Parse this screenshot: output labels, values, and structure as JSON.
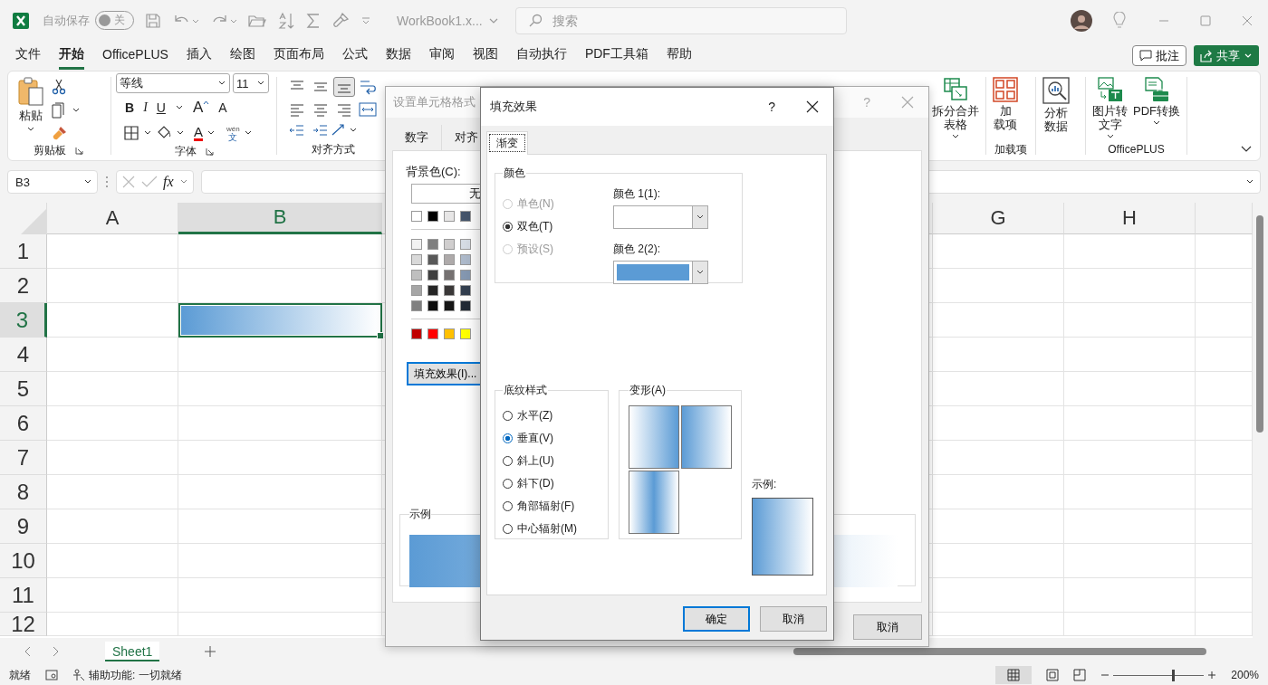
{
  "titlebar": {
    "autosave_label": "自动保存",
    "autosave_toggle": {
      "label": "关",
      "on": false
    },
    "filename": "WorkBook1.x...",
    "search": {
      "placeholder": "搜索"
    }
  },
  "menu_tabs": [
    {
      "label": "文件",
      "selected": false
    },
    {
      "label": "开始",
      "selected": true
    },
    {
      "label": "OfficePLUS",
      "selected": false
    },
    {
      "label": "插入",
      "selected": false
    },
    {
      "label": "绘图",
      "selected": false
    },
    {
      "label": "页面布局",
      "selected": false
    },
    {
      "label": "公式",
      "selected": false
    },
    {
      "label": "数据",
      "selected": false
    },
    {
      "label": "审阅",
      "selected": false
    },
    {
      "label": "视图",
      "selected": false
    },
    {
      "label": "自动执行",
      "selected": false
    },
    {
      "label": "PDF工具箱",
      "selected": false
    },
    {
      "label": "帮助",
      "selected": false
    }
  ],
  "header_actions": {
    "comment": "批注",
    "share": "共享"
  },
  "ribbon": {
    "clipboard": {
      "paste": "粘贴",
      "group": "剪贴板"
    },
    "font": {
      "name": "等线",
      "size": "11",
      "bold": "B",
      "italic": "I",
      "underline": "U",
      "grow": "A",
      "shrink": "A",
      "font_color": "A",
      "phonetic_top": "wén",
      "phonetic_bottom": "文",
      "group": "字体"
    },
    "alignment": {
      "vertical": [
        {
          "selected": false
        },
        {
          "selected": false
        },
        {
          "selected": true
        }
      ],
      "group": "对齐方式"
    },
    "right_groups": [
      {
        "buttons": [
          {
            "kind": "split",
            "lines": [
              "拆分合并",
              "表格"
            ],
            "caret": true
          }
        ]
      },
      {
        "label": "加载项",
        "buttons": [
          {
            "kind": "addins",
            "lines": [
              "加",
              "载项"
            ],
            "caret": false
          }
        ]
      },
      {
        "buttons": [
          {
            "kind": "analyze",
            "lines": [
              "分析",
              "数据"
            ],
            "caret": false
          }
        ]
      },
      {
        "label": "OfficePLUS",
        "buttons": [
          {
            "kind": "image-text",
            "lines": [
              "图片转",
              "文字"
            ],
            "caret": true
          },
          {
            "kind": "pdf",
            "lines": [
              "PDF转换"
            ],
            "caret": true
          }
        ]
      }
    ]
  },
  "formula_bar": {
    "name_box": "B3",
    "fx": "fx"
  },
  "grid": {
    "columns": [
      {
        "label": "A",
        "selected": false
      },
      {
        "label": "B",
        "selected": true
      },
      {
        "label": "G",
        "selected": false
      },
      {
        "label": "H",
        "selected": false
      }
    ],
    "rows": [
      {
        "label": "1",
        "selected": false
      },
      {
        "label": "2",
        "selected": false
      },
      {
        "label": "3",
        "selected": true
      },
      {
        "label": "4",
        "selected": false
      },
      {
        "label": "5",
        "selected": false
      },
      {
        "label": "6",
        "selected": false
      },
      {
        "label": "7",
        "selected": false
      },
      {
        "label": "8",
        "selected": false
      },
      {
        "label": "9",
        "selected": false
      },
      {
        "label": "10",
        "selected": false
      },
      {
        "label": "11",
        "selected": false
      },
      {
        "label": "12",
        "selected": false
      }
    ]
  },
  "sheet_tabs": [
    {
      "label": "Sheet1",
      "selected": true
    }
  ],
  "status_bar": {
    "ready": "就绪",
    "accessibility": "辅助功能: 一切就绪",
    "zoom": "200%",
    "zoom_slider": {
      "level": 0.66
    }
  },
  "format_dialog": {
    "title": "设置单元格格式",
    "help": "?",
    "tabs": [
      {
        "label": "数字",
        "selected": false
      },
      {
        "label": "对齐",
        "selected": false
      }
    ],
    "background_label": "背景色(C):",
    "no_color": "无",
    "swatch_rows": [
      {
        "swatches": [
          {
            "color": "#ffffff"
          },
          {
            "color": "#000000"
          },
          {
            "color": "#e7e6e6"
          },
          {
            "color": "#44546a"
          }
        ]
      },
      {
        "swatches": [
          {
            "color": "#f2f2f2"
          },
          {
            "color": "#7f7f7f"
          },
          {
            "color": "#d0cece"
          },
          {
            "color": "#d6dce4"
          }
        ]
      },
      {
        "swatches": [
          {
            "color": "#d9d9d9"
          },
          {
            "color": "#595959"
          },
          {
            "color": "#aeaaaa"
          },
          {
            "color": "#adb9ca"
          }
        ]
      },
      {
        "swatches": [
          {
            "color": "#bfbfbf"
          },
          {
            "color": "#404040"
          },
          {
            "color": "#757171"
          },
          {
            "color": "#8497b0"
          }
        ]
      },
      {
        "swatches": [
          {
            "color": "#a6a6a6"
          },
          {
            "color": "#262626"
          },
          {
            "color": "#3a3838"
          },
          {
            "color": "#333f4f"
          }
        ]
      },
      {
        "swatches": [
          {
            "color": "#808080"
          },
          {
            "color": "#0d0d0d"
          },
          {
            "color": "#161616"
          },
          {
            "color": "#222a35"
          }
        ]
      },
      {
        "swatches": [
          {
            "color": "#c00000"
          },
          {
            "color": "#ff0000"
          },
          {
            "color": "#ffc000"
          },
          {
            "color": "#ffff00"
          }
        ]
      }
    ],
    "fill_effects_button": "填充效果(I)...",
    "sample_label": "示例",
    "cancel": "取消"
  },
  "fill_dialog": {
    "title": "填充效果",
    "help": "?",
    "tabs": [
      {
        "label": "渐变",
        "selected": true
      }
    ],
    "colors_group": "颜色",
    "color_modes": [
      {
        "label": "单色(N)",
        "selected": false,
        "disabled": true
      },
      {
        "label": "双色(T)",
        "selected": true,
        "disabled": false
      },
      {
        "label": "预设(S)",
        "selected": false,
        "disabled": true
      }
    ],
    "color_1_label": "颜色 1(1):",
    "color_2_label": "颜色 2(2):",
    "shading_group": "底纹样式",
    "shading_styles": [
      {
        "label": "水平(Z)",
        "selected": false
      },
      {
        "label": "垂直(V)",
        "selected": true
      },
      {
        "label": "斜上(U)",
        "selected": false
      },
      {
        "label": "斜下(D)",
        "selected": false
      },
      {
        "label": "角部辐射(F)",
        "selected": false
      },
      {
        "label": "中心辐射(M)",
        "selected": false
      }
    ],
    "variants_group": "变形(A)",
    "variants": [
      {
        "kind": "light-to-dark"
      },
      {
        "kind": "dark-to-light"
      },
      {
        "kind": "center"
      }
    ],
    "sample_label": "示例:",
    "ok": "确定",
    "cancel": "取消"
  }
}
